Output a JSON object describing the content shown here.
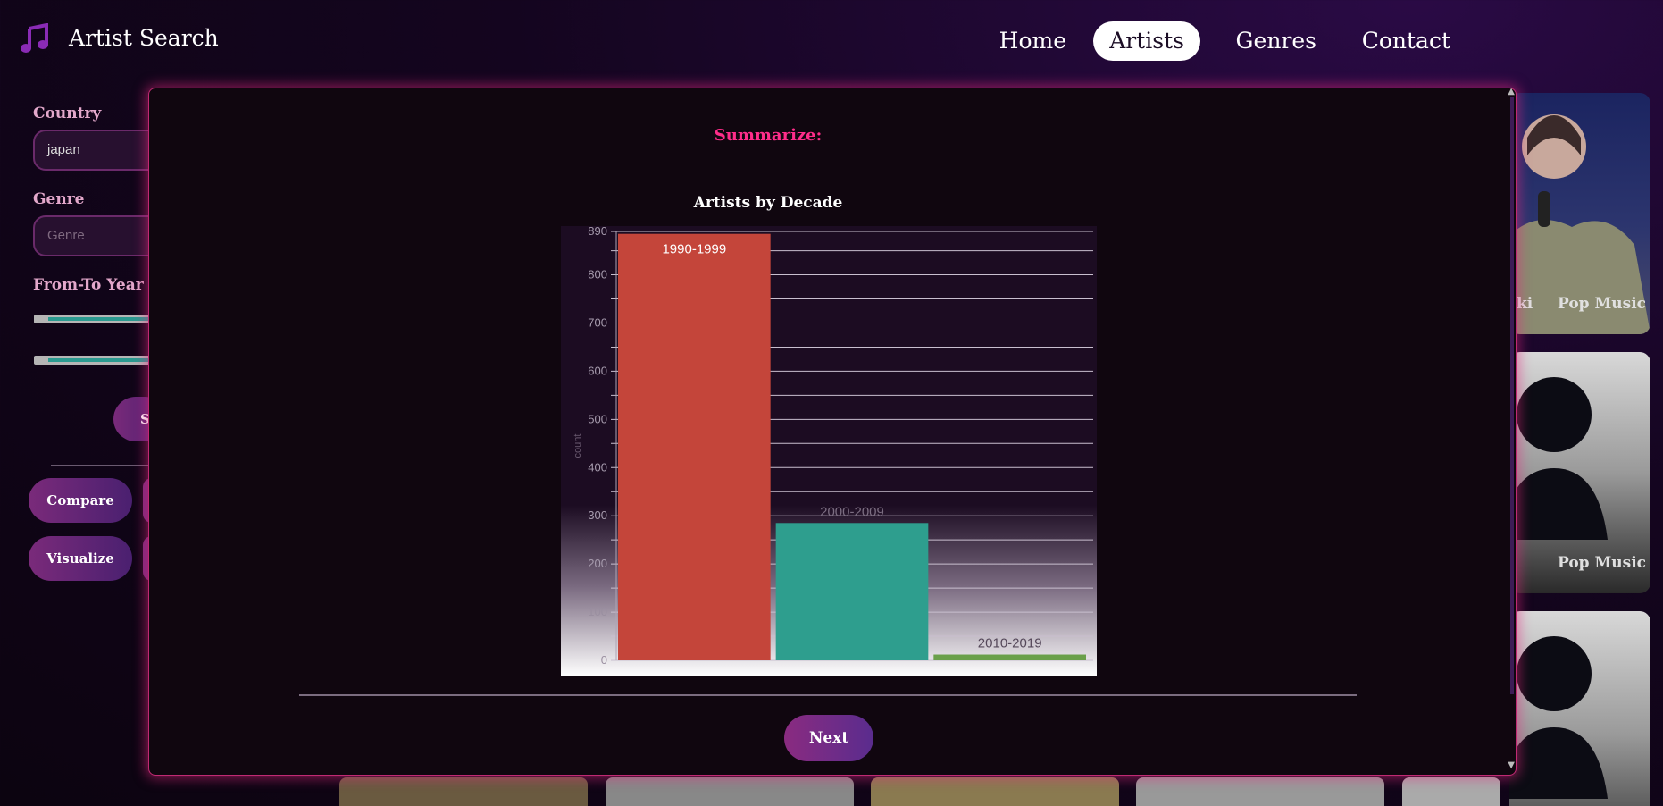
{
  "app": {
    "title": "Artist Search",
    "icon": "music-note-icon"
  },
  "nav": {
    "items": [
      {
        "label": "Home",
        "active": false
      },
      {
        "label": "Artists",
        "active": true
      },
      {
        "label": "Genres",
        "active": false
      },
      {
        "label": "Contact",
        "active": false
      }
    ]
  },
  "filters": {
    "country_label": "Country",
    "country_value": "japan",
    "genre_label": "Genre",
    "genre_placeholder": "Genre",
    "year_label": "From-To Year",
    "search_button_partial": "S",
    "compare_label": "Compare",
    "visualize_label": "Visualize"
  },
  "cards": [
    {
      "name_partial": "ki",
      "genre": "Pop Music"
    },
    {
      "genre": "Pop Music"
    }
  ],
  "modal": {
    "summarize_label": "Summarize:",
    "next_label": "Next"
  },
  "chart_data": {
    "type": "bar",
    "title": "Artists by Decade",
    "ylabel": "count",
    "xlabel": "",
    "categories": [
      "1990-1999",
      "2000-2009",
      "2010-2019"
    ],
    "values": [
      885,
      285,
      12
    ],
    "ylim": [
      0,
      890
    ],
    "yticks": [
      0,
      100,
      200,
      300,
      400,
      500,
      600,
      700,
      800,
      890
    ],
    "bar_colors": [
      "#c4453a",
      "#2e9e8e",
      "#6aa04a"
    ],
    "data_labels_inside": true,
    "grid": true
  }
}
